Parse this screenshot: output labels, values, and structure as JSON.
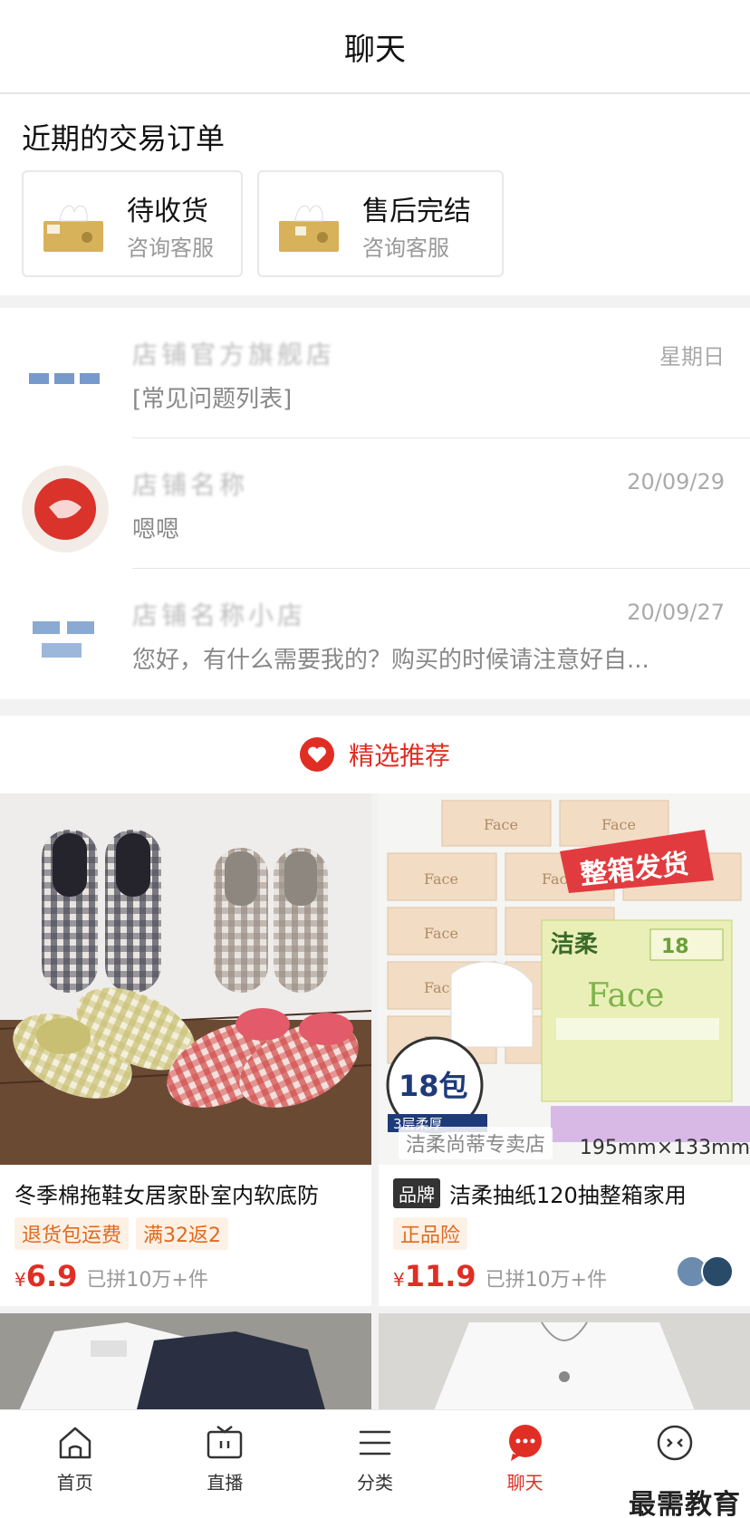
{
  "header": {
    "title": "聊天"
  },
  "orders": {
    "title": "近期的交易订单",
    "cards": [
      {
        "status": "待收货",
        "sub": "咨询客服"
      },
      {
        "status": "售后完结",
        "sub": "咨询客服"
      }
    ]
  },
  "chats": [
    {
      "name": "店铺官方旗舰店",
      "time": "星期日",
      "message": "[常见问题列表]"
    },
    {
      "name": "店铺名称",
      "time": "20/09/29",
      "message": "嗯嗯"
    },
    {
      "name": "店铺名称小店",
      "time": "20/09/27",
      "message": "您好，有什么需要我的？购买的时候请注意好自..."
    }
  ],
  "recommend": {
    "title": "精选推荐"
  },
  "products": [
    {
      "title": "冬季棉拖鞋女居家卧室内软底防",
      "tags": [
        "退货包运费",
        "满32返2"
      ],
      "currency": "¥",
      "price": "6.9",
      "sold": "已拼10万+件"
    },
    {
      "brand_badge": "品牌",
      "title": "洁柔抽纸120抽整箱家用",
      "tags": [
        "正品险"
      ],
      "currency": "¥",
      "price": "11.9",
      "sold": "已拼10万+件",
      "store_overlay": "洁柔尚蒂专卖店",
      "size_overlay": "195mm×133mm",
      "image_texts": {
        "promo": "整箱发货",
        "brand": "洁柔",
        "product": "Face",
        "count": "18包",
        "layer": "3层柔厚"
      }
    }
  ],
  "tabbar": {
    "items": [
      {
        "label": "首页",
        "icon": "home-icon"
      },
      {
        "label": "直播",
        "icon": "tv-icon"
      },
      {
        "label": "分类",
        "icon": "list-icon"
      },
      {
        "label": "聊天",
        "icon": "chat-icon",
        "active": true
      },
      {
        "label": "",
        "icon": "more-icon"
      }
    ]
  },
  "watermark": "最需教育",
  "colors": {
    "accent": "#e02e24",
    "tag_bg": "#fdf1e6",
    "tag_text": "#e06a1e"
  }
}
